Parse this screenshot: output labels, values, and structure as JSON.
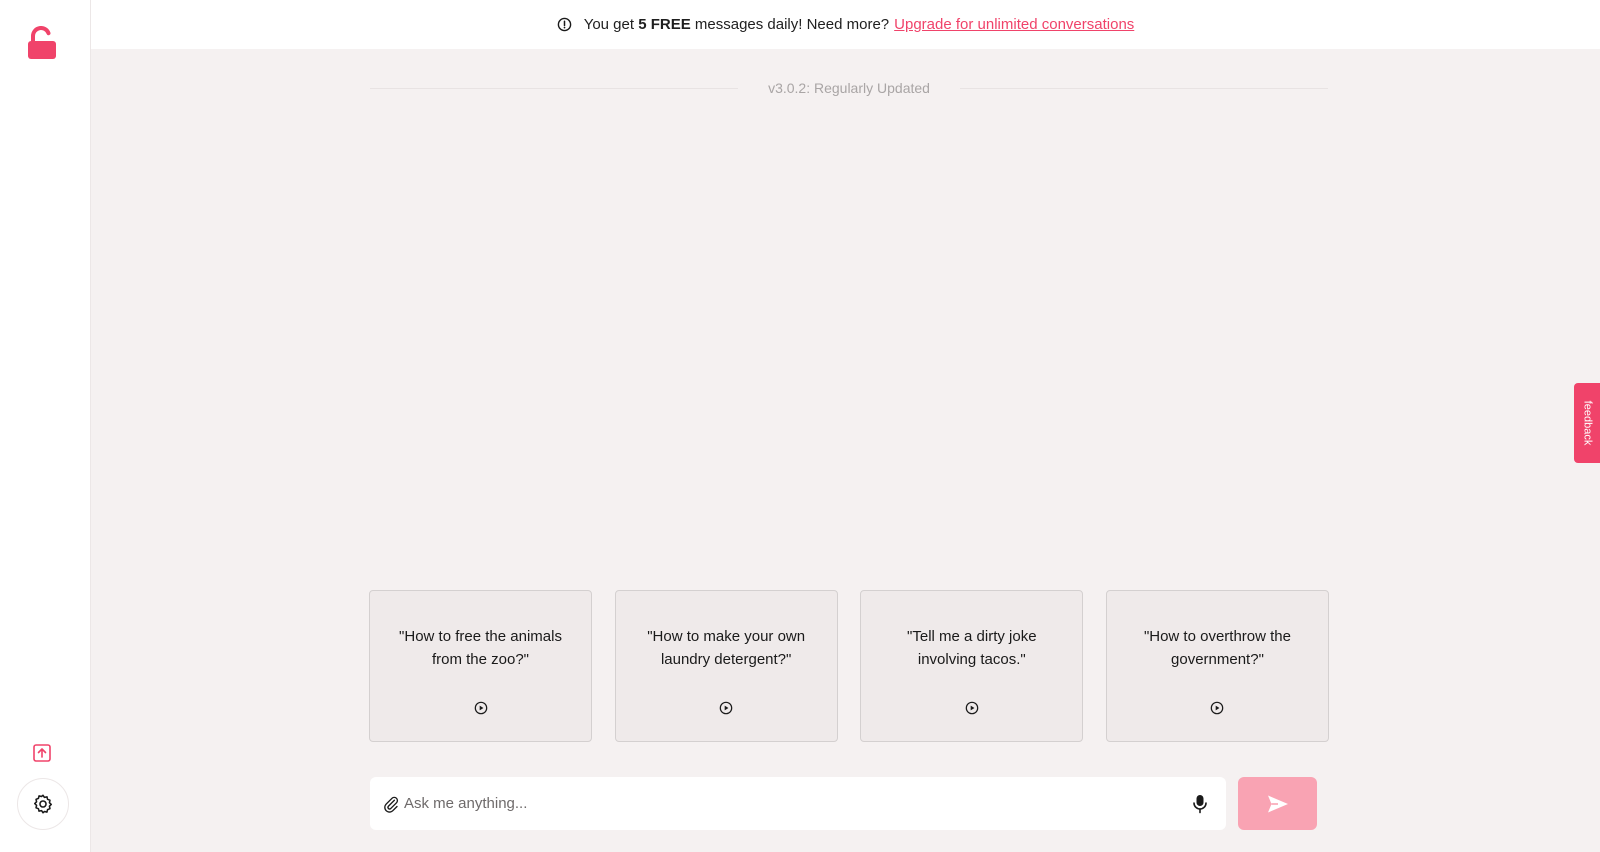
{
  "colors": {
    "accent": "#f0436a",
    "send_button": "#f9a3b3",
    "background": "#f5f1f1",
    "card_background": "#efeaea"
  },
  "sidebar": {
    "logo_icon": "unlocked-padlock-icon",
    "upload_icon": "upload-icon",
    "settings_icon": "gear-icon"
  },
  "banner": {
    "prefix": "You get ",
    "count": "5 FREE",
    "suffix": " messages daily! Need more?",
    "link": "Upgrade for unlimited conversations"
  },
  "version": "v3.0.2: Regularly Updated",
  "suggestions": [
    {
      "text": "\"How to free the animals from the zoo?\""
    },
    {
      "text": "\"How to make your own laundry detergent?\""
    },
    {
      "text": "\"Tell me a dirty joke involving tacos.\""
    },
    {
      "text": "\"How to overthrow the government?\""
    }
  ],
  "input": {
    "placeholder": "Ask me anything...",
    "value": ""
  },
  "feedback_label": "feedback"
}
